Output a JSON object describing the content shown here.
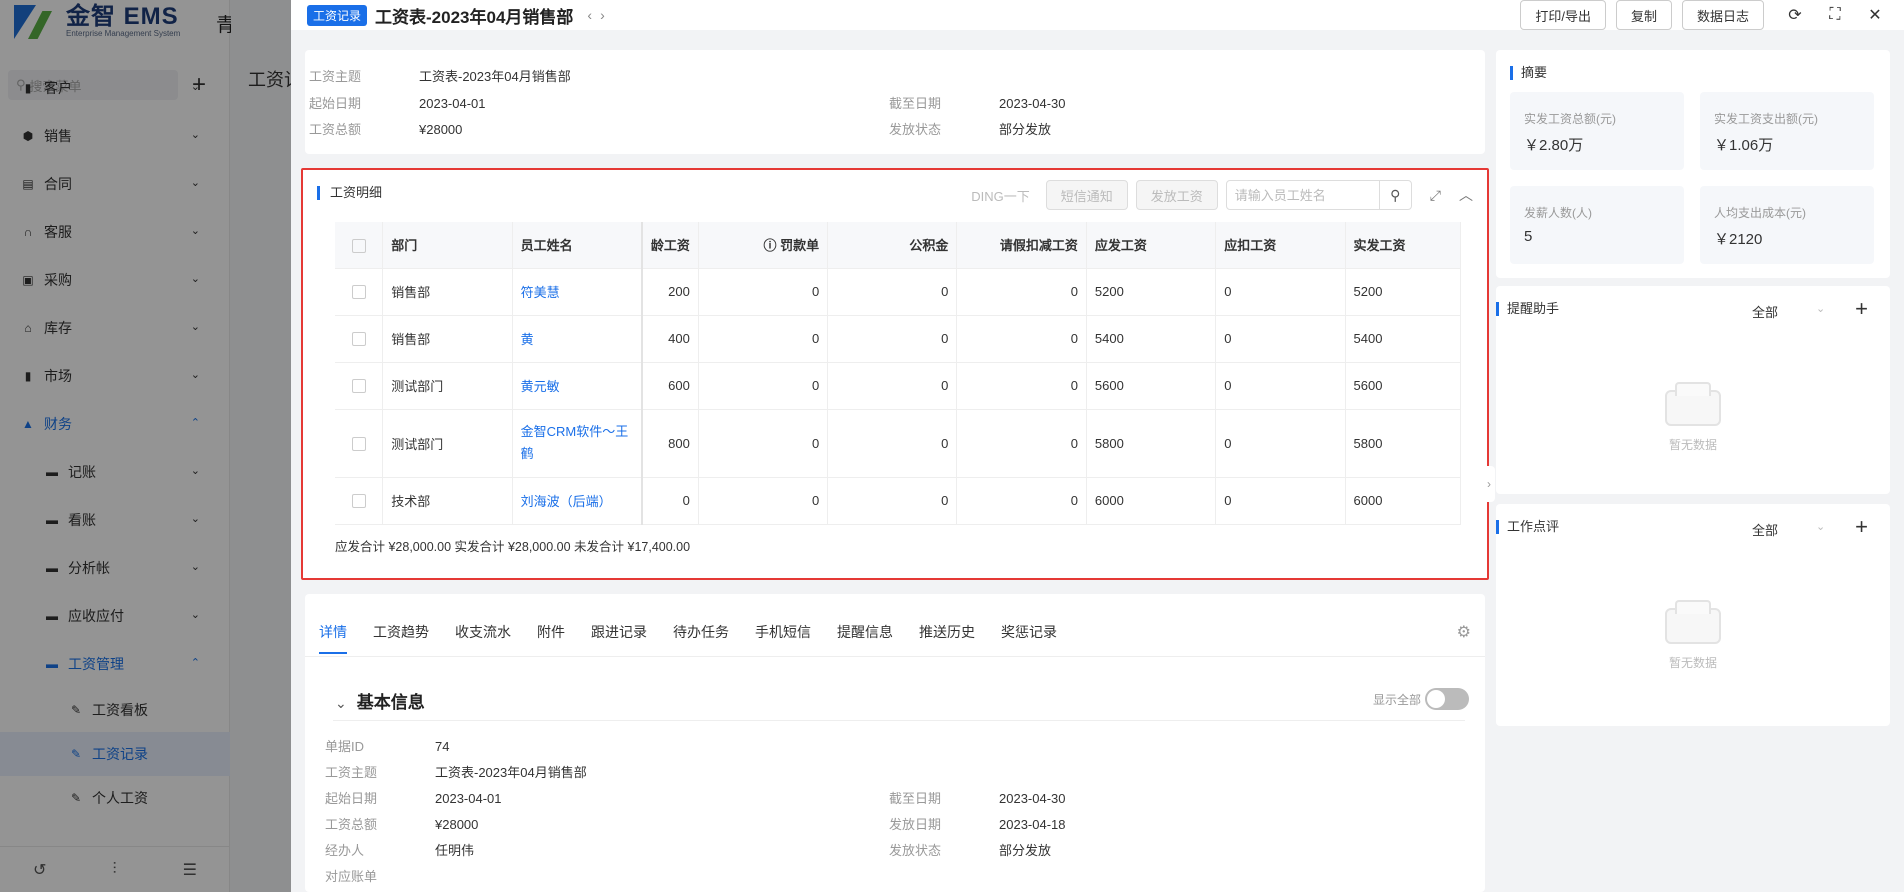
{
  "bg": {
    "logo_text": "金智 EMS",
    "logo_sub": "Enterprise Management System",
    "company": "青岛金智",
    "search_placeholder": "搜索菜单",
    "bg_title": "工资记",
    "nav": [
      {
        "label": "客户",
        "icon": "user-icon"
      },
      {
        "label": "销售",
        "icon": "sales-icon"
      },
      {
        "label": "合同",
        "icon": "contract-icon"
      },
      {
        "label": "客服",
        "icon": "headset-icon"
      },
      {
        "label": "采购",
        "icon": "purchase-icon"
      },
      {
        "label": "库存",
        "icon": "warehouse-icon"
      },
      {
        "label": "市场",
        "icon": "market-icon"
      },
      {
        "label": "财务",
        "icon": "finance-icon"
      }
    ],
    "finance_sub": [
      "记账",
      "看账",
      "分析帐",
      "应收应付",
      "工资管理"
    ],
    "salary_sub": [
      "工资看板",
      "工资记录",
      "个人工资"
    ]
  },
  "header": {
    "tag": "工资记录",
    "title": "工资表-2023年04月销售部",
    "actions": [
      "打印/导出",
      "复制",
      "数据日志"
    ]
  },
  "info": {
    "subject_label": "工资主题",
    "subject": "工资表-2023年04月销售部",
    "start_label": "起始日期",
    "start": "2023-04-01",
    "end_label": "截至日期",
    "end": "2023-04-30",
    "total_label": "工资总额",
    "total": "¥28000",
    "status_label": "发放状态",
    "status": "部分发放"
  },
  "detail": {
    "title": "工资明细",
    "ding": "DING一下",
    "sms_btn": "短信通知",
    "pay_btn": "发放工资",
    "search_placeholder": "请输入员工姓名",
    "columns": [
      "部门",
      "员工姓名",
      "龄工资",
      "罚款单",
      "公积金",
      "请假扣减工资",
      "应发工资",
      "应扣工资",
      "实发工资"
    ],
    "rows": [
      {
        "dept": "销售部",
        "name": "符美慧",
        "age": "200",
        "fine": "0",
        "fund": "0",
        "leave": "0",
        "due": "5200",
        "deduct": "0",
        "paid": "5200"
      },
      {
        "dept": "销售部",
        "name": "黄",
        "age": "400",
        "fine": "0",
        "fund": "0",
        "leave": "0",
        "due": "5400",
        "deduct": "0",
        "paid": "5400"
      },
      {
        "dept": "测试部门",
        "name": "黄元敏",
        "age": "600",
        "fine": "0",
        "fund": "0",
        "leave": "0",
        "due": "5600",
        "deduct": "0",
        "paid": "5600"
      },
      {
        "dept": "测试部门",
        "name": "金智CRM软件～王鹤",
        "age": "800",
        "fine": "0",
        "fund": "0",
        "leave": "0",
        "due": "5800",
        "deduct": "0",
        "paid": "5800"
      },
      {
        "dept": "技术部",
        "name": "刘海波（后端）",
        "age": "0",
        "fine": "0",
        "fund": "0",
        "leave": "0",
        "due": "6000",
        "deduct": "0",
        "paid": "6000"
      }
    ],
    "summary": "应发合计 ¥28,000.00 实发合计 ¥28,000.00 未发合计 ¥17,400.00"
  },
  "tabs": [
    "详情",
    "工资趋势",
    "收支流水",
    "附件",
    "跟进记录",
    "待办任务",
    "手机短信",
    "提醒信息",
    "推送历史",
    "奖惩记录"
  ],
  "basic": {
    "title": "基本信息",
    "show_all": "显示全部",
    "fields_left": [
      {
        "k": "单据ID",
        "v": "74"
      },
      {
        "k": "工资主题",
        "v": "工资表-2023年04月销售部"
      },
      {
        "k": "起始日期",
        "v": "2023-04-01"
      },
      {
        "k": "工资总额",
        "v": "¥28000"
      },
      {
        "k": "经办人",
        "v": "任明伟"
      },
      {
        "k": "对应账单",
        "v": ""
      }
    ],
    "fields_right": [
      {
        "k": "截至日期",
        "v": "2023-04-30"
      },
      {
        "k": "发放日期",
        "v": "2023-04-18"
      },
      {
        "k": "发放状态",
        "v": "部分发放"
      }
    ]
  },
  "summary_panel": {
    "title": "摘要",
    "stats": [
      {
        "label": "实发工资总额(元)",
        "value": "￥2.80万"
      },
      {
        "label": "实发工资支出额(元)",
        "value": "￥1.06万"
      },
      {
        "label": "发薪人数(人)",
        "value": "5"
      },
      {
        "label": "人均支出成本(元)",
        "value": "￥2120"
      }
    ]
  },
  "reminder": {
    "title": "提醒助手",
    "filter": "全部",
    "empty": "暂无数据"
  },
  "review": {
    "title": "工作点评",
    "filter": "全部",
    "empty": "暂无数据"
  }
}
